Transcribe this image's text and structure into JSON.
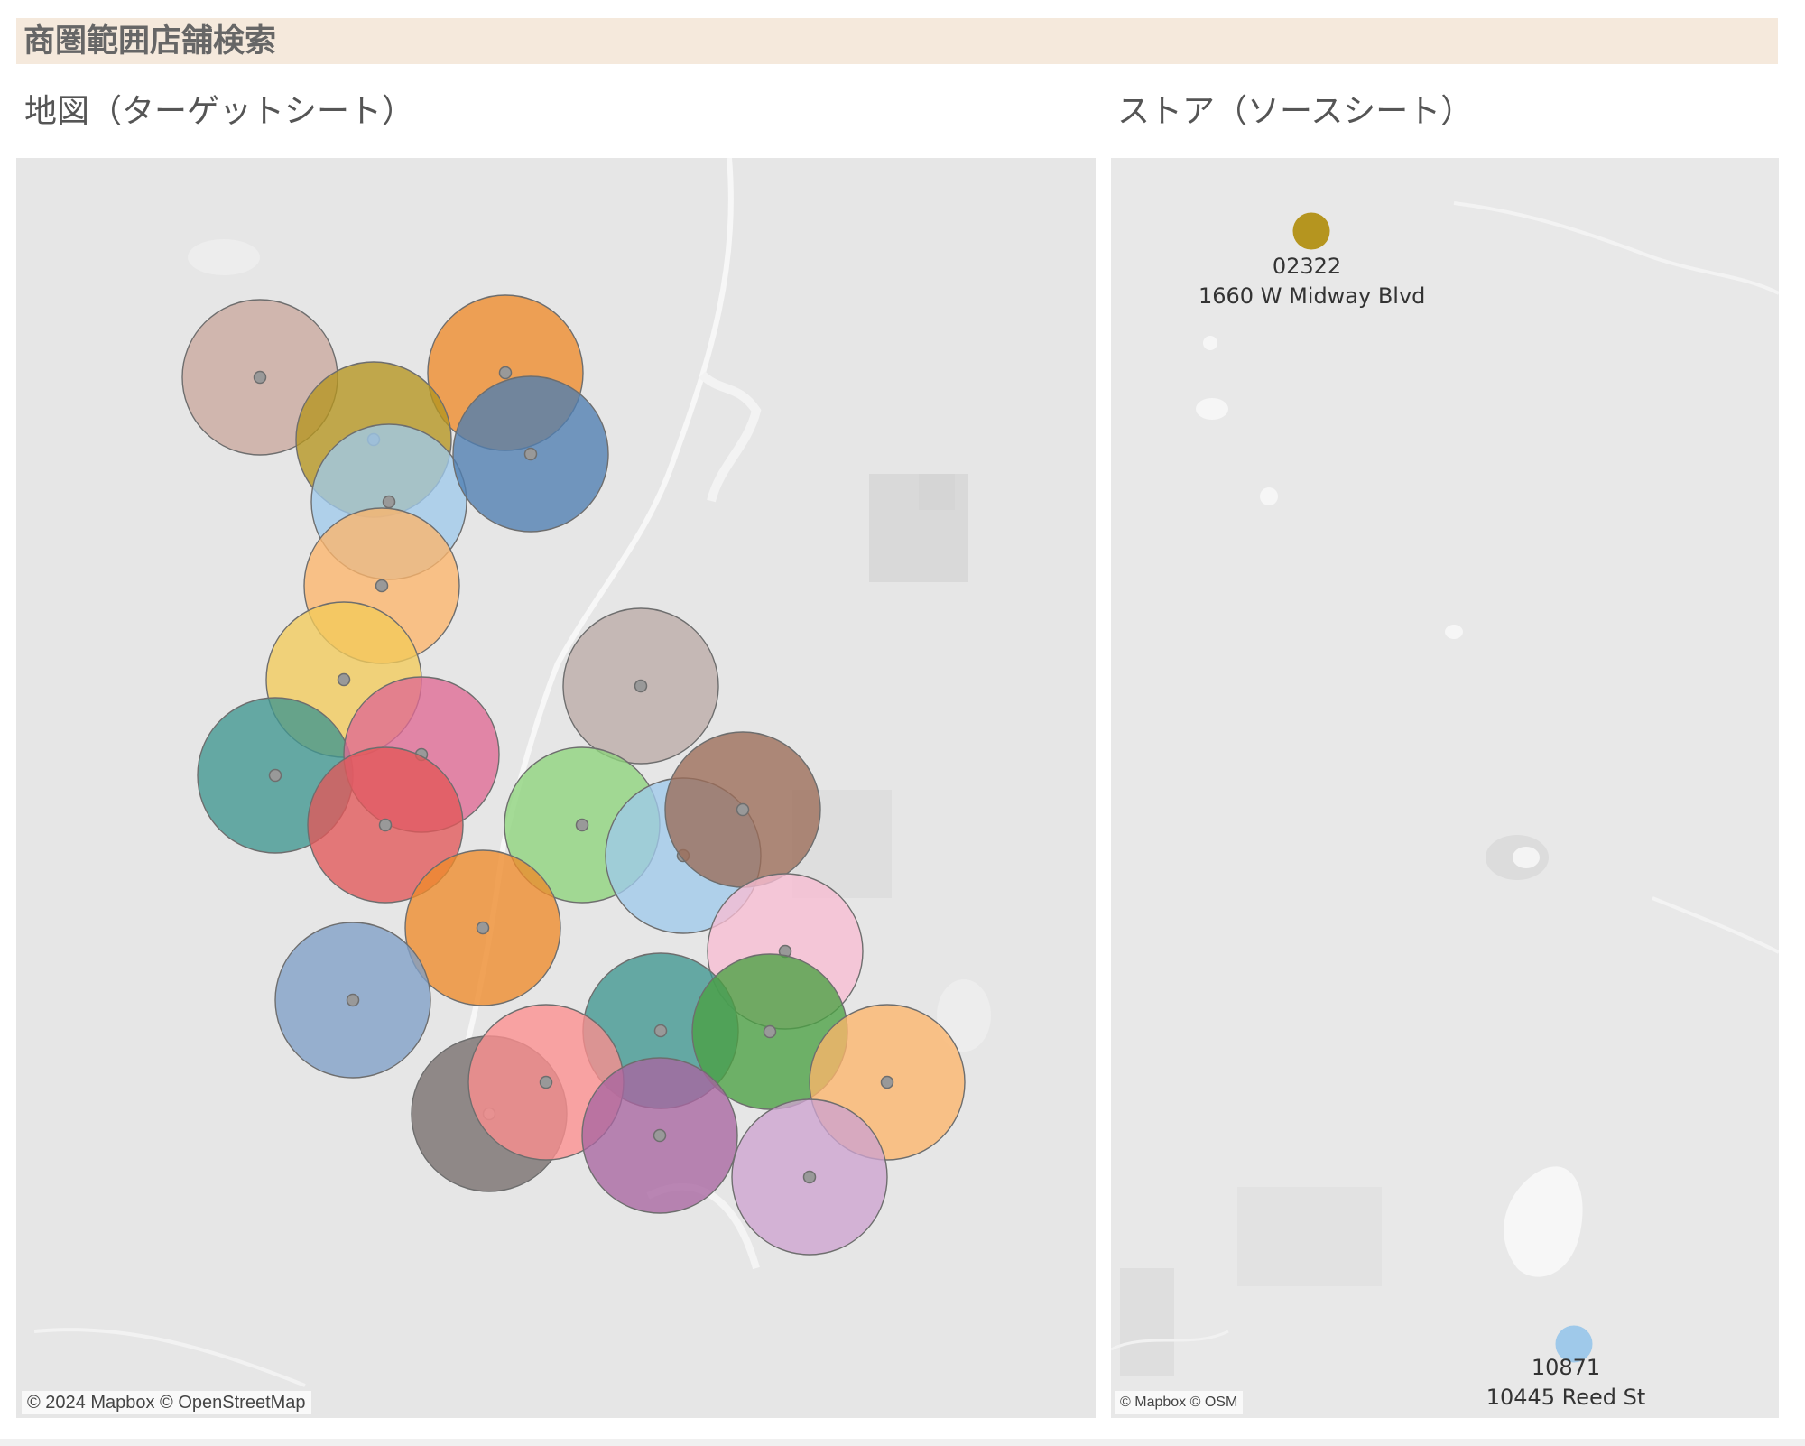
{
  "dashboard": {
    "title": "商圏範囲店舗検索"
  },
  "target_sheet": {
    "title": "地図（ターゲットシート）",
    "credit": "© 2024 Mapbox © OpenStreetMap",
    "circle_colors": [
      "#c9a89e",
      "#ee8a2a",
      "#b5951f",
      "#9fc9ea",
      "#4e7eb1",
      "#fdb56a",
      "#f2ca5a",
      "#bbaba6",
      "#3f968f",
      "#df6993",
      "#e15759",
      "#8dd37b",
      "#9fc9ea",
      "#9b6c57",
      "#ee8a2a",
      "#f7bcd2",
      "#7f9fc6",
      "#3f968f",
      "#4aa043",
      "#fdb56a",
      "#766d6b",
      "#fc8e8e",
      "#a865a0",
      "#cda3cf"
    ]
  },
  "source_sheet": {
    "title": "ストア（ソースシート）",
    "credit": "© Mapbox © OSM",
    "stores": [
      {
        "id": "02322",
        "address": "1660 W Midway Blvd",
        "color": "#b5951f"
      },
      {
        "id": "10871",
        "address": "10445 Reed St",
        "color": "#9fc9ea"
      }
    ]
  }
}
